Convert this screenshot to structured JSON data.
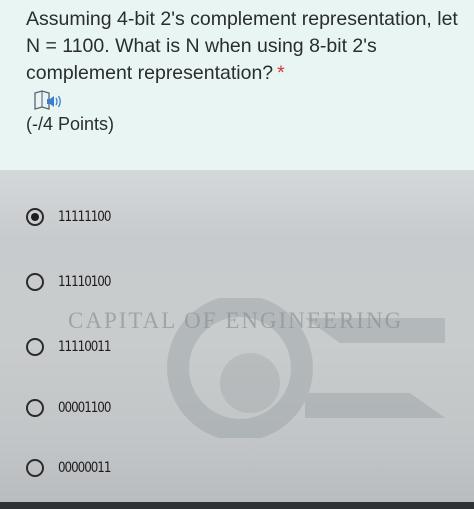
{
  "question": {
    "text": "Assuming 4-bit 2's complement representation, let N = 1100. What is N when using 8-bit 2's complement representation?",
    "required_marker": "*",
    "speaker_icon": "speaker-icon",
    "points": "(-/4 Points)"
  },
  "watermark": {
    "text": "CAPITAL OF ENGINEERING"
  },
  "options": [
    {
      "label": "11111100",
      "selected": true
    },
    {
      "label": "11110100",
      "selected": false
    },
    {
      "label": "11110011",
      "selected": false
    },
    {
      "label": "00001100",
      "selected": false
    },
    {
      "label": "00000011",
      "selected": false
    }
  ],
  "colors": {
    "panel": "#e8f5f3",
    "text": "#2a2d2e",
    "required": "#d63a3a"
  }
}
